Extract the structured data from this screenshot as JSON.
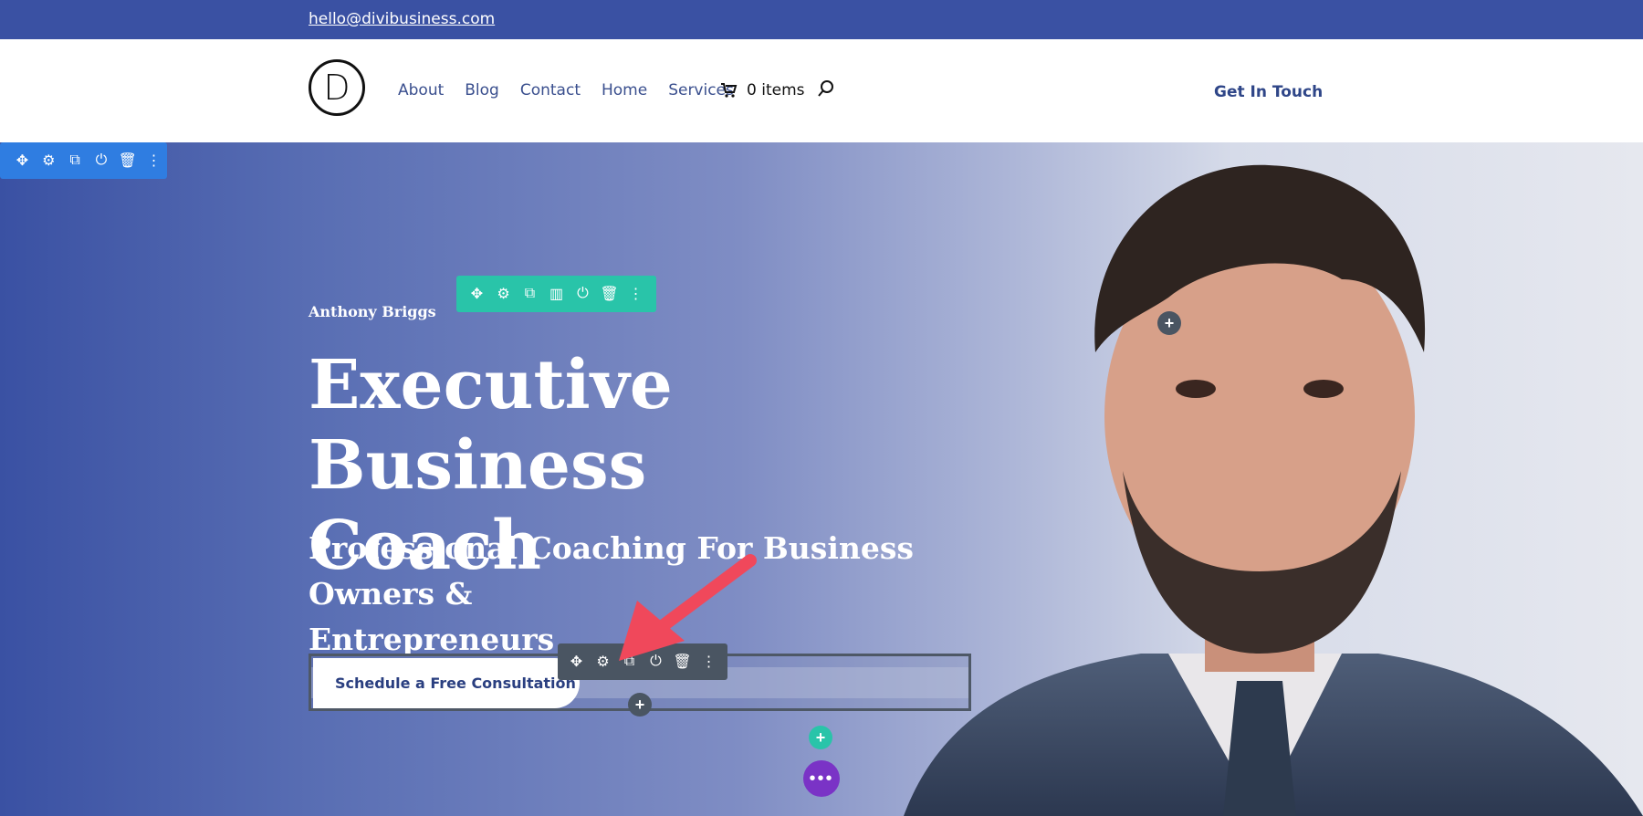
{
  "topbar": {
    "email": "hello@divibusiness.com"
  },
  "header": {
    "logo_letter": "D",
    "nav": [
      "About",
      "Blog",
      "Contact",
      "Home",
      "Services"
    ],
    "cart_text": "0 items",
    "cta": "Get In Touch"
  },
  "hero": {
    "name": "Anthony Briggs",
    "title_line1": "Executive Business",
    "title_line2": "Coach",
    "subtitle_line1": "Professional Coaching For Business Owners &",
    "subtitle_line2": "Entrepreneurs",
    "button": "Schedule a Free Consultation"
  },
  "builder": {
    "section_toolbar": [
      "move-icon",
      "gear-icon",
      "duplicate-icon",
      "power-icon",
      "trash-icon",
      "more-icon"
    ],
    "row_toolbar": [
      "move-icon",
      "gear-icon",
      "duplicate-icon",
      "columns-icon",
      "power-icon",
      "trash-icon",
      "more-icon"
    ],
    "module_toolbar": [
      "move-icon",
      "gear-icon",
      "duplicate-icon",
      "power-icon",
      "trash-icon",
      "more-icon"
    ],
    "colors": {
      "section": "#2f7de1",
      "row": "#29c4a9",
      "module": "#4a5562",
      "main_button": "#7a33c6",
      "arrow": "#f0485b"
    }
  }
}
